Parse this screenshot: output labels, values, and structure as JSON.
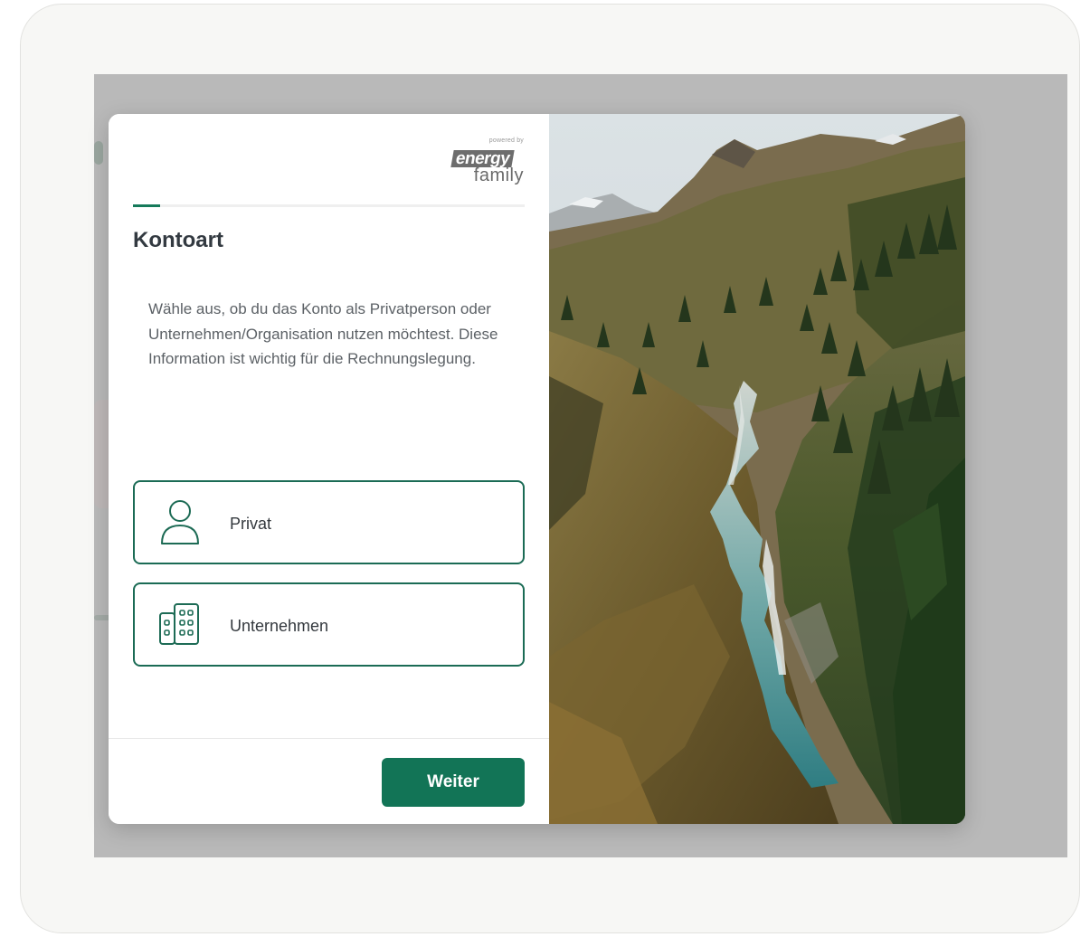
{
  "brand": {
    "powered_by": "powered by",
    "word1": "energy",
    "word2": "family"
  },
  "wizard": {
    "progress": 0.07,
    "title": "Kontoart",
    "description": "Wähle aus, ob du das Konto als Privatperson oder Unternehmen/Organisation nutzen möchtest. Diese Information ist wichtig für die Rechnungslegung.",
    "options": [
      {
        "label": "Privat",
        "icon": "person-icon"
      },
      {
        "label": "Unternehmen",
        "icon": "buildings-icon"
      }
    ],
    "next_label": "Weiter"
  },
  "colors": {
    "accent": "#127456",
    "option_border": "#1b6b55",
    "overlay": "#b9b9b9"
  },
  "image": {
    "subject": "mountain-valley-with-river"
  }
}
